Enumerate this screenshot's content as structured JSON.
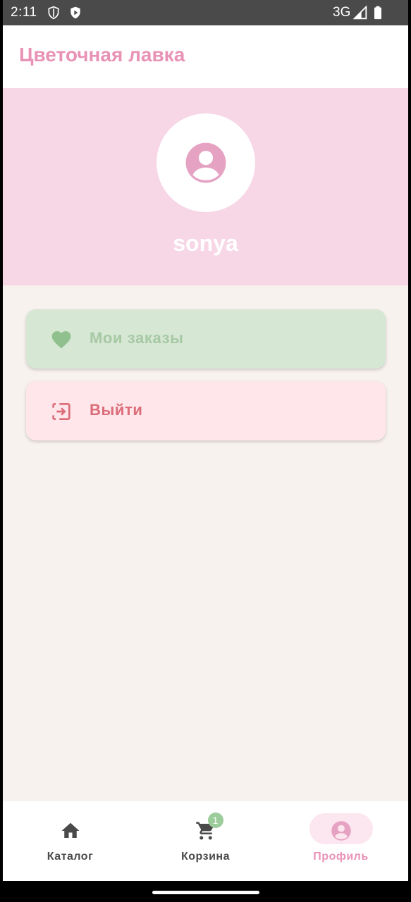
{
  "status_bar": {
    "time": "2:11",
    "network": "3G",
    "icons": [
      "shield-icon",
      "play-protect-icon",
      "signal-icon",
      "battery-icon"
    ]
  },
  "app_bar": {
    "title": "Цветочная лавка"
  },
  "profile": {
    "avatar_icon": "account-circle-icon",
    "username": "sonya"
  },
  "menu": {
    "orders": {
      "label": "Мои заказы",
      "icon": "heart-icon"
    },
    "logout": {
      "label": "Выйти",
      "icon": "logout-icon"
    }
  },
  "bottom_nav": {
    "catalog": {
      "label": "Каталог",
      "icon": "home-icon"
    },
    "cart": {
      "label": "Корзина",
      "icon": "cart-icon",
      "badge": "1"
    },
    "profile": {
      "label": "Профиль",
      "icon": "account-circle-icon",
      "active": true
    }
  },
  "colors": {
    "accent_pink": "#e892b6",
    "hero_bg": "#f7d6e6",
    "page_bg": "#f8f2ee",
    "orders_card_bg": "#d6e7d4",
    "orders_text": "#a6c9a4",
    "logout_card_bg": "#fee6ea",
    "logout_text": "#dc6c77",
    "badge_green": "#9ccc9a"
  }
}
